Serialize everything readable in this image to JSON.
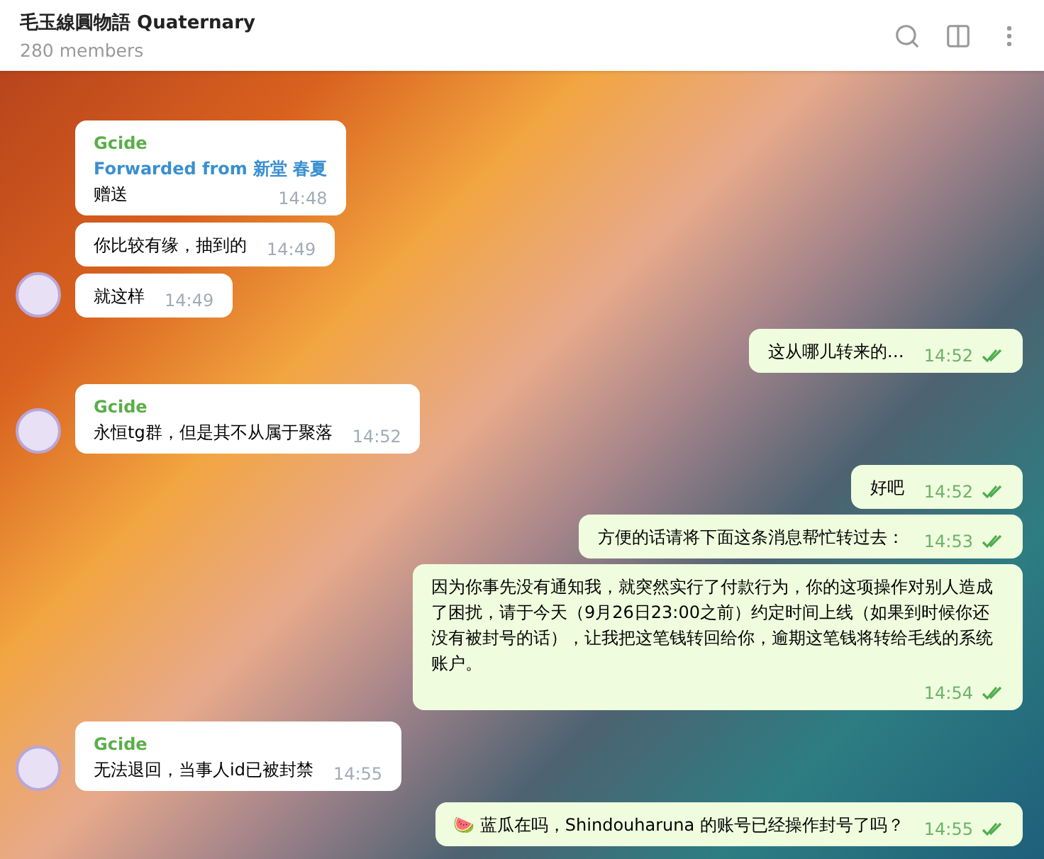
{
  "header": {
    "title": "毛玉線圓物語 Quaternary",
    "subtitle": "280 members"
  },
  "messages": [
    {
      "kind": "incoming",
      "avatar": false,
      "sender": "Gcide",
      "forwarded": "Forwarded from 新堂 春夏",
      "text": "赠送",
      "time": "14:48"
    },
    {
      "kind": "incoming",
      "avatar": false,
      "text": "你比较有缘，抽到的",
      "time": "14:49"
    },
    {
      "kind": "incoming",
      "avatar": true,
      "text": "就这样",
      "time": "14:49"
    },
    {
      "kind": "outgoing",
      "read": true,
      "text": "这从哪儿转来的…",
      "time": "14:52"
    },
    {
      "kind": "incoming",
      "avatar": true,
      "sender": "Gcide",
      "text": "永恒tg群，但是其不从属于聚落",
      "time": "14:52"
    },
    {
      "kind": "outgoing",
      "read": true,
      "text": "好吧",
      "time": "14:52"
    },
    {
      "kind": "outgoing",
      "read": true,
      "text": "方便的话请将下面这条消息帮忙转过去：",
      "time": "14:53"
    },
    {
      "kind": "outgoing",
      "read": true,
      "text": "因为你事先没有通知我，就突然实行了付款行为，你的这项操作对别人造成了困扰，请于今天（9月26日23:00之前）约定时间上线（如果到时候你还没有被封号的话），让我把这笔钱转回给你，逾期这笔钱将转给毛线的系统账户。",
      "time": "14:54"
    },
    {
      "kind": "incoming",
      "avatar": true,
      "sender": "Gcide",
      "text": "无法退回，当事人id已被封禁",
      "time": "14:55"
    },
    {
      "kind": "outgoing",
      "read": true,
      "text": "🍉 蓝瓜在吗，Shindouharuna 的账号已经操作封号了吗？",
      "time": "14:55"
    }
  ]
}
